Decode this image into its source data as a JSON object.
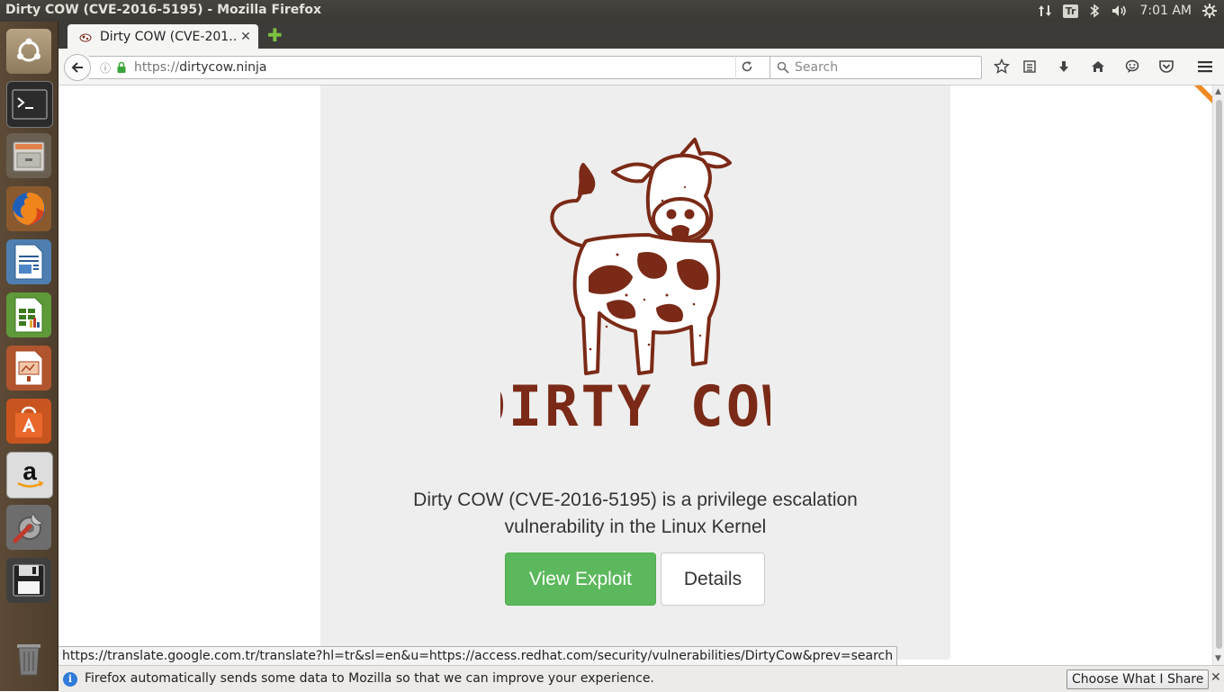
{
  "panel": {
    "window_title": "Dirty COW (CVE-2016-5195) - Mozilla Firefox",
    "tray": {
      "keyboard_layout": "Tr",
      "clock": "7:01 AM"
    }
  },
  "launcher": {
    "items": [
      {
        "name": "ubuntu-dash",
        "icon": "ubuntu-logo-icon"
      },
      {
        "name": "terminal",
        "icon": "terminal-icon"
      },
      {
        "name": "files",
        "icon": "file-cabinet-icon"
      },
      {
        "name": "firefox",
        "icon": "firefox-icon"
      },
      {
        "name": "libreoffice-writer",
        "icon": "writer-document-icon"
      },
      {
        "name": "libreoffice-calc",
        "icon": "calc-spreadsheet-icon"
      },
      {
        "name": "libreoffice-impress",
        "icon": "impress-presentation-icon"
      },
      {
        "name": "software-center",
        "icon": "shopping-bag-icon"
      },
      {
        "name": "amazon",
        "icon": "amazon-icon"
      },
      {
        "name": "system-settings",
        "icon": "wrench-gear-icon"
      },
      {
        "name": "save-disk",
        "icon": "floppy-disk-icon"
      },
      {
        "name": "trash",
        "icon": "trash-icon"
      }
    ]
  },
  "browser": {
    "tab_title": "Dirty COW (CVE-201…",
    "url_protocol": "https://",
    "url_host": "dirtycow.ninja",
    "search_placeholder": "Search"
  },
  "page": {
    "logo_text": "DIRTY COW",
    "hero_text_line1": "Dirty COW (CVE-2016-5195) is a privilege escalation",
    "hero_text_line2": "vulnerability in the Linux Kernel",
    "primary_button": "View Exploit",
    "secondary_button": "Details"
  },
  "status_link": "https://translate.google.com.tr/translate?hl=tr&sl=en&u=https://access.redhat.com/security/vulnerabilities/DirtyCow&prev=search",
  "notification": {
    "text": "Firefox automatically sends some data to Mozilla so that we can improve your experience.",
    "button": "Choose What I Share"
  },
  "colors": {
    "accent_green": "#5cb85c",
    "cow_brown": "#7a2a17",
    "panel_bg": "#eeeeee"
  }
}
